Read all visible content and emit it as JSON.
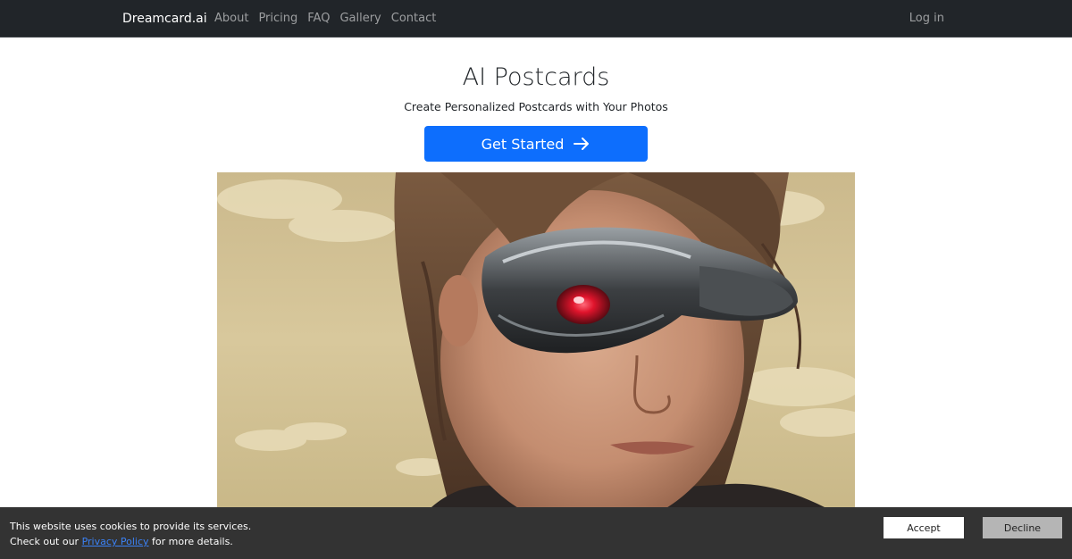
{
  "navbar": {
    "brand": "Dreamcard.ai",
    "links": [
      {
        "label": "About"
      },
      {
        "label": "Pricing"
      },
      {
        "label": "FAQ"
      },
      {
        "label": "Gallery"
      },
      {
        "label": "Contact"
      }
    ],
    "login_label": "Log in",
    "background": "#212529"
  },
  "hero": {
    "title": "AI Postcards",
    "subtitle": "Create Personalized Postcards with Your Photos",
    "cta_label": "Get Started",
    "cta_icon": "arrow-right-icon",
    "cta_color": "#0d6efd"
  },
  "cookie_banner": {
    "line1": "This website uses cookies to provide its services.",
    "line2_prefix": "Check out our",
    "privacy_link": "Privacy Policy",
    "line2_suffix": "for more details.",
    "accept_label": "Accept",
    "decline_label": "Decline"
  }
}
